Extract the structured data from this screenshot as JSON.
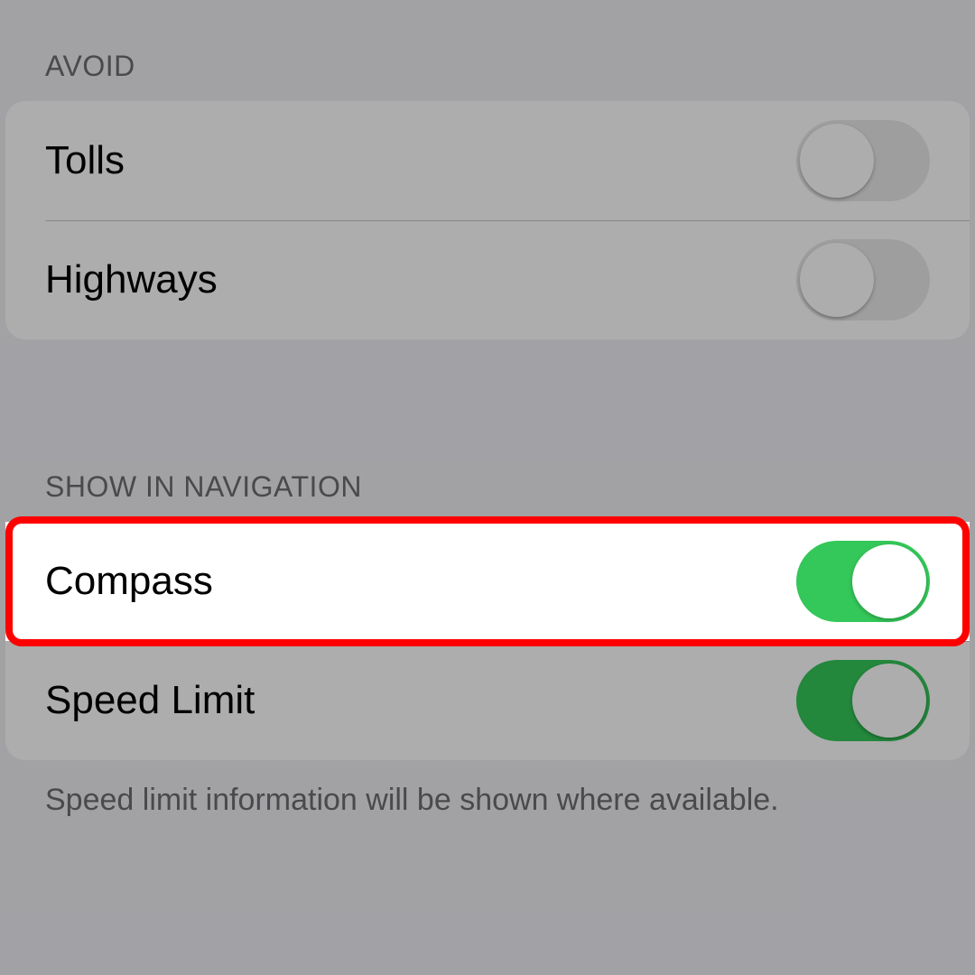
{
  "sections": {
    "avoid": {
      "header": "AVOID",
      "rows": {
        "tolls": {
          "label": "Tolls",
          "on": false
        },
        "highways": {
          "label": "Highways",
          "on": false
        }
      }
    },
    "showInNav": {
      "header": "SHOW IN NAVIGATION",
      "rows": {
        "compass": {
          "label": "Compass",
          "on": true
        },
        "speedLimit": {
          "label": "Speed Limit",
          "on": true
        }
      },
      "footer": "Speed limit information will be shown where available."
    }
  },
  "highlight": {
    "target": "compass-row",
    "color": "#ff0000"
  }
}
